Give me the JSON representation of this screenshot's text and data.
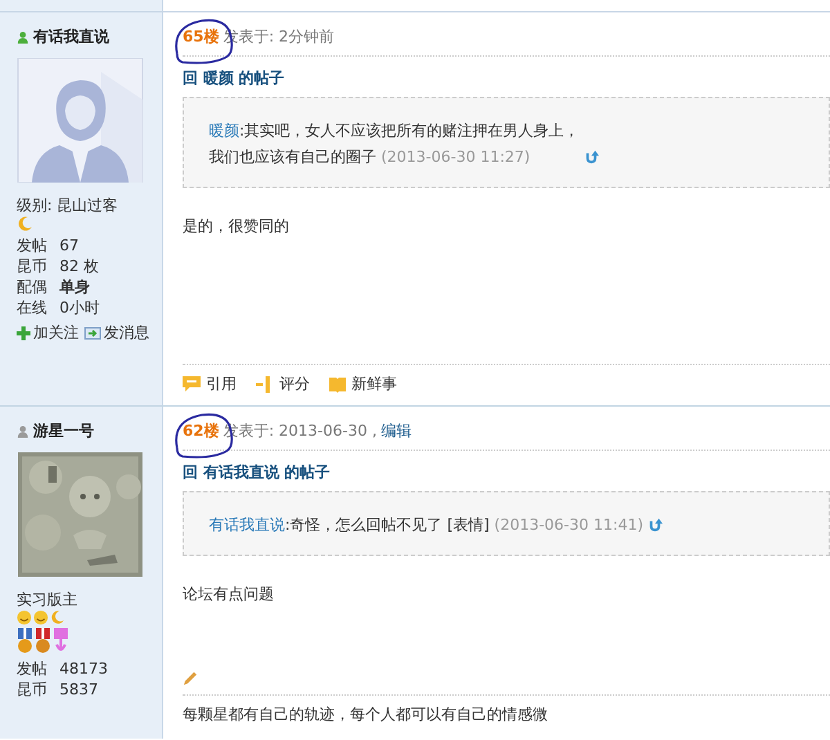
{
  "posts": [
    {
      "author": {
        "name": "有话我直说",
        "online": true,
        "kind": "member",
        "rank": "级别: 昆山过客",
        "stats": [
          {
            "label": "发帖",
            "value": "67",
            "bold": false
          },
          {
            "label": "昆币",
            "value": "82 枚",
            "bold": false
          },
          {
            "label": "配偶",
            "value": "单身",
            "bold": true
          },
          {
            "label": "在线",
            "value": "0小时",
            "bold": false
          }
        ],
        "links": [
          {
            "label": "加关注",
            "kind": "follow"
          },
          {
            "label": "发消息",
            "kind": "message"
          }
        ]
      },
      "floor": "65楼",
      "posted": "发表于: 2分钟前",
      "reply_title": "回 暖颜 的帖子",
      "quote": {
        "author": "暖颜",
        "lines": [
          ":其实吧，女人不应该把所有的赌注押在男人身上，",
          "我们也应该有自己的圈子"
        ],
        "time": "(2013-06-30 11:27)"
      },
      "body": "是的，很赞同的",
      "actions": [
        {
          "label": "引用",
          "kind": "quote"
        },
        {
          "label": "评分",
          "kind": "rate"
        },
        {
          "label": "新鲜事",
          "kind": "feed"
        }
      ]
    },
    {
      "author": {
        "name": "游星一号",
        "online": false,
        "kind": "moderator",
        "rank": "实习版主",
        "stats": [
          {
            "label": "发帖",
            "value": "48173",
            "bold": false
          },
          {
            "label": "昆币",
            "value": "5837",
            "bold": false
          }
        ]
      },
      "floor": "62楼",
      "posted": "发表于: 2013-06-30 ,",
      "edit": "编辑",
      "reply_title": "回 有话我直说 的帖子",
      "quote": {
        "author": "有话我直说",
        "lines": [
          ":奇怪，怎么回帖不见了 [表情]"
        ],
        "time": "(2013-06-30 11:41)"
      },
      "body": "论坛有点问题",
      "signature": "每颗星都有自己的轨迹，每个人都可以有自己的情感微"
    }
  ]
}
